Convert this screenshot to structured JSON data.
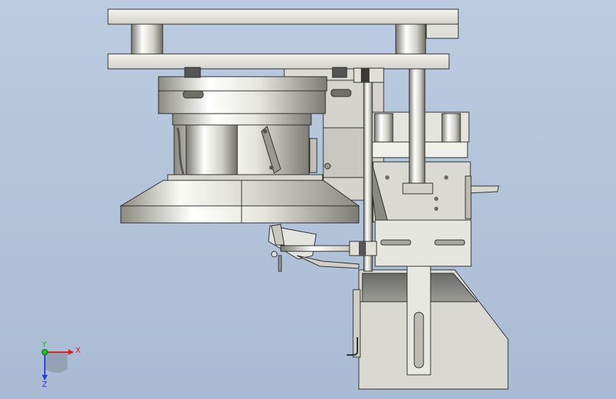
{
  "triad": {
    "x_label": "X",
    "y_label": "Y",
    "z_label": "Z",
    "x_color": "#e02020",
    "y_color": "#20c020",
    "z_color": "#2040e0"
  },
  "colors": {
    "background": "#b4c5dc",
    "metal_light": "#f2f2ec",
    "metal_mid": "#c8c8c0",
    "metal_dark": "#6e6e68",
    "outline": "#2a2a2a",
    "gray_box": "#8c8c88"
  }
}
